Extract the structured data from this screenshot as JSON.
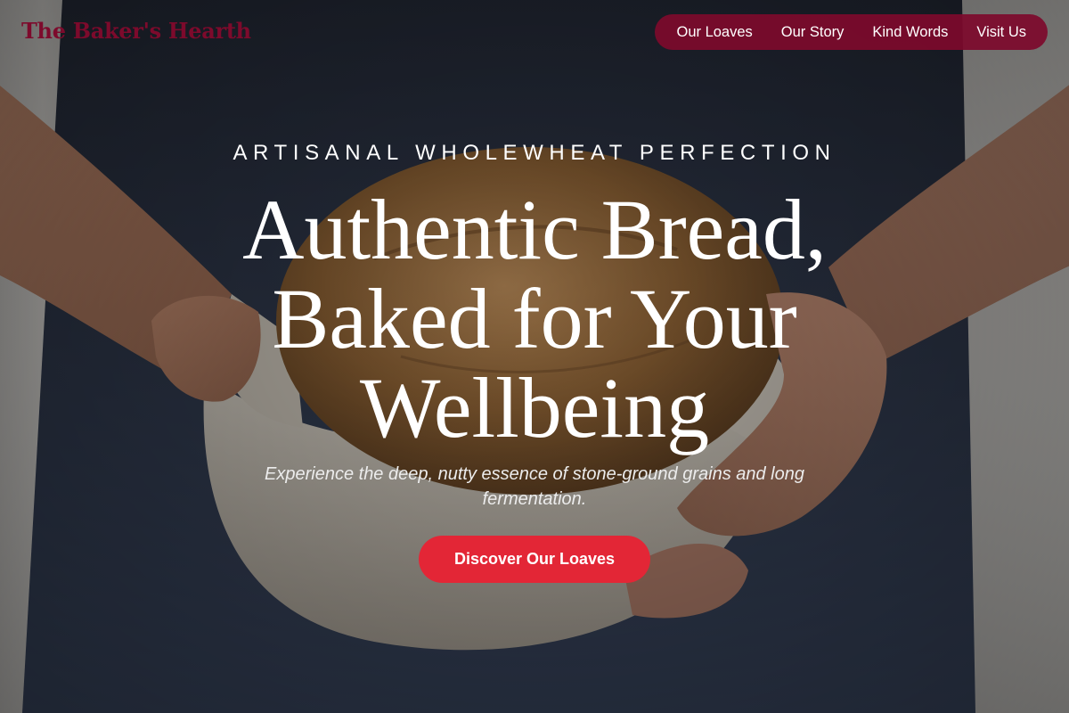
{
  "header": {
    "brand": "The Baker's Hearth",
    "nav": [
      {
        "label": "Our Loaves"
      },
      {
        "label": "Our Story"
      },
      {
        "label": "Kind Words"
      },
      {
        "label": "Visit Us"
      }
    ]
  },
  "hero": {
    "eyebrow": "ARTISANAL WHOLEWHEAT PERFECTION",
    "headline_lines": [
      "Authentic Bread,",
      "Baked for Your",
      "Wellbeing"
    ],
    "subhead": "Experience the deep, nutty essence of stone-ground grains and long fermentation.",
    "cta_label": "Discover Our Loaves"
  },
  "colors": {
    "brand": "#7d0a2c",
    "nav_background": "#7d0a2c",
    "cta_background": "#e32636",
    "text": "#ffffff"
  }
}
